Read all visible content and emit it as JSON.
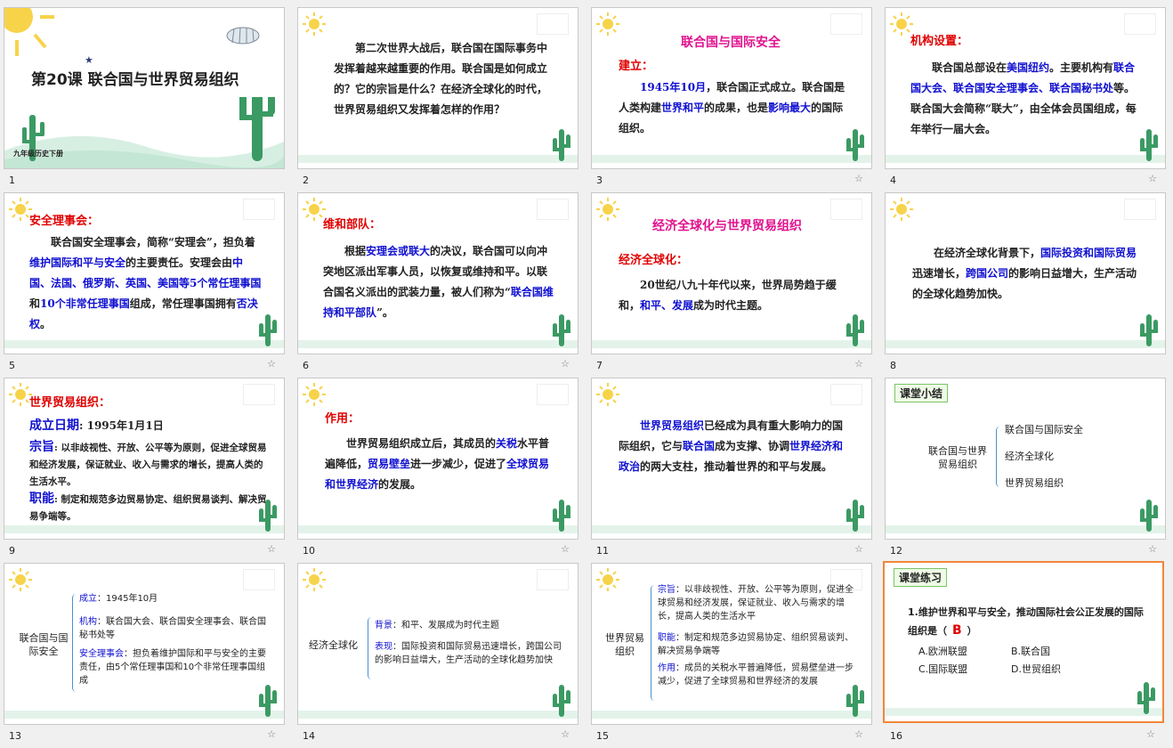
{
  "slides": [
    {
      "num": "1",
      "title": "第20课  联合国与世界贸易组织",
      "subtitle": "九年级历史下册"
    },
    {
      "num": "2",
      "body": "第二次世界大战后，联合国在国际事务中发挥着越来越重要的作用。联合国是如何成立的？它的宗旨是什么？在经济全球化的时代，世界贸易组织又发挥着怎样的作用？"
    },
    {
      "num": "3",
      "heading": "联合国与国际安全",
      "label": "建立：",
      "p1": "1945年10月",
      "p2": "，联合国正式成立。联合国是人类构建",
      "p3": "世界和平",
      "p4": "的成果，也是",
      "p5": "影响最大",
      "p6": "的国际组织。"
    },
    {
      "num": "4",
      "label": "机构设置：",
      "p1": "联合国总部设在",
      "p2": "美国纽约",
      "p3": "。主要机构有",
      "p4": "联合国大会、联合国安全理事会、联合国秘书处",
      "p5": "等。联合国大会简称“联大”，由全体会员国组成，每年举行一届大会。"
    },
    {
      "num": "5",
      "label": "安全理事会：",
      "p1": "联合国安全理事会，简称“安理会”，担负着",
      "p2": "维护国际和平与安全",
      "p3": "的主要责任。安理会由",
      "p4": "中国、法国、俄罗斯、英国、美国等5个常任理事国",
      "p5": "和",
      "p6": "10个非常任理事国",
      "p7": "组成，常任理事国拥有",
      "p8": "否决权",
      "p9": "。"
    },
    {
      "num": "6",
      "label": "维和部队：",
      "p1": "根据",
      "p2": "安理会或联大",
      "p3": "的决议，联合国可以向冲突地区派出军事人员，以恢复或维持和平。以联合国名义派出的武装力量，被人们称为“",
      "p4": "联合国维持和平部队",
      "p5": "”。"
    },
    {
      "num": "7",
      "heading": "经济全球化与世界贸易组织",
      "label": "经济全球化：",
      "p1": "20世纪八九十年代以来，世界局势趋于缓和，",
      "p2": "和平、发展",
      "p3": "成为时代主题。"
    },
    {
      "num": "8",
      "p1": "在经济全球化背景下，",
      "p2": "国际投资和国际贸易",
      "p3": "迅速增长，",
      "p4": "跨国公司",
      "p5": "的影响日益增大，生产活动的全球化趋势加快。"
    },
    {
      "num": "9",
      "label": "世界贸易组织：",
      "date_label": "成立日期",
      "date_value": ": 1995年1月1日",
      "aim_label": "宗旨",
      "aim_value": ": 以非歧视性、开放、公平等为原则，促进全球贸易和经济发展，保证就业、收入与需求的增长，提高人类的生活水平。",
      "func_label": "职能",
      "func_value": ": 制定和规范多边贸易协定、组织贸易谈判、解决贸易争端等。"
    },
    {
      "num": "10",
      "label": "作用：",
      "p1": "世界贸易组织成立后，其成员的",
      "p2": "关税",
      "p3": "水平普遍降低，",
      "p4": "贸易壁垒",
      "p5": "进一步减少，促进了",
      "p6": "全球贸易和世界经济",
      "p7": "的发展。"
    },
    {
      "num": "11",
      "p1": "世界贸易组织",
      "p2": "已经成为具有重大影响力的国际组织，它与",
      "p3": "联合国",
      "p4": "成为支撑、协调",
      "p5": "世界经济和政治",
      "p6": "的两大支柱，推动着世界的和平与发展。"
    },
    {
      "num": "12",
      "tag": "课堂小结",
      "root": "联合国与世界贸易组织",
      "items": [
        "联合国与国际安全",
        "经济全球化",
        "世界贸易组织"
      ]
    },
    {
      "num": "13",
      "root": "联合国与国际安全",
      "b1l": "成立",
      "b1v": "：1945年10月",
      "b2l": "机构",
      "b2v": "：联合国大会、联合国安全理事会、联合国秘书处等",
      "b3l": "安全理事会",
      "b3v": "：担负着维护国际和平与安全的主要责任，由5个常任理事国和10个非常任理事国组成"
    },
    {
      "num": "14",
      "root": "经济全球化",
      "b1l": "背景",
      "b1v": "：和平、发展成为时代主题",
      "b2l": "表现",
      "b2v": "：国际投资和国际贸易迅速增长，跨国公司的影响日益增大，生产活动的全球化趋势加快"
    },
    {
      "num": "15",
      "root": "世界贸易组织",
      "b1l": "宗旨",
      "b1v": "：以非歧视性、开放、公平等为原则，促进全球贸易和经济发展，保证就业、收入与需求的增长，提高人类的生活水平",
      "b2l": "职能",
      "b2v": "：制定和规范多边贸易协定、组织贸易谈判、解决贸易争端等",
      "b3l": "作用",
      "b3v": "：成员的关税水平普遍降低，贸易壁垒进一步减少，促进了全球贸易和世界经济的发展"
    },
    {
      "num": "16",
      "tag": "课堂练习",
      "q": "1.维护世界和平与安全，推动国际社会公正发展的国际组织是（",
      "answer": "B",
      "q_end": "）",
      "opts": [
        "A.欧洲联盟",
        "B.联合国",
        "C.国际联盟",
        "D.世贸组织"
      ]
    }
  ],
  "star": "☆",
  "colors": {
    "selected_border": "#f0883a",
    "accent_blue": "#1010d0",
    "accent_red": "#e00000",
    "heading_magenta": "#e0128e"
  }
}
